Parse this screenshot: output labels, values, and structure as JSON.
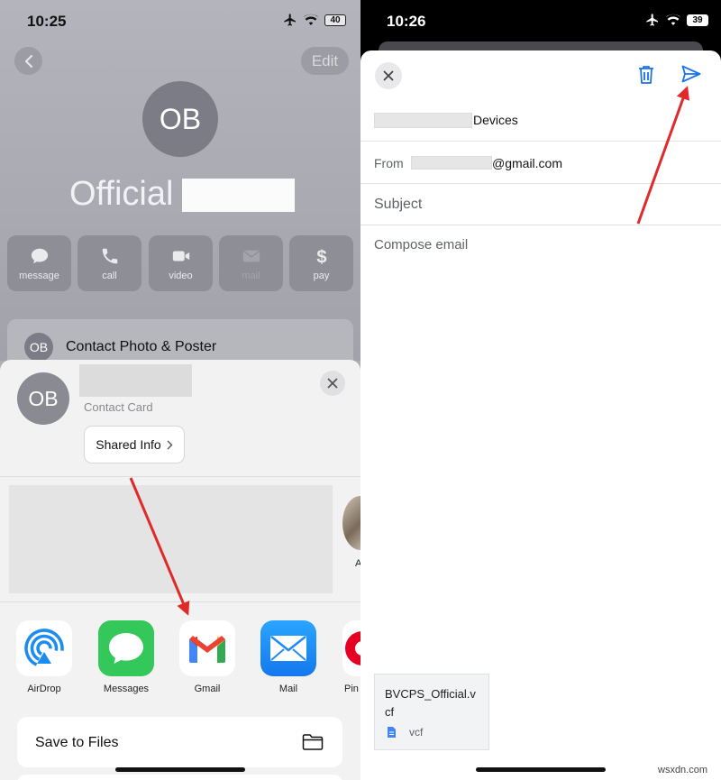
{
  "left": {
    "status": {
      "time": "10:25",
      "battery": "40"
    },
    "header": {
      "edit_label": "Edit"
    },
    "contact": {
      "initials": "OB",
      "name": "Official"
    },
    "actions": [
      {
        "label": "message",
        "icon": "message-bubble-icon",
        "enabled": true
      },
      {
        "label": "call",
        "icon": "phone-icon",
        "enabled": true
      },
      {
        "label": "video",
        "icon": "video-camera-icon",
        "enabled": true
      },
      {
        "label": "mail",
        "icon": "mail-icon",
        "enabled": false
      },
      {
        "label": "pay",
        "icon": "dollar-icon",
        "enabled": true
      }
    ],
    "contact_photo_row": {
      "initials": "OB",
      "label": "Contact Photo & Poster"
    },
    "share_sheet": {
      "initials": "OB",
      "subtitle": "Contact Card",
      "shared_info_label": "Shared Info",
      "people_peek_label": "A",
      "apps": [
        {
          "label": "AirDrop",
          "icon": "airdrop-icon"
        },
        {
          "label": "Messages",
          "icon": "messages-app-icon"
        },
        {
          "label": "Gmail",
          "icon": "gmail-app-icon"
        },
        {
          "label": "Mail",
          "icon": "mail-app-icon"
        },
        {
          "label": "Pin",
          "icon": "pinterest-app-icon"
        }
      ],
      "save_to_files_label": "Save to Files"
    }
  },
  "right": {
    "status": {
      "time": "10:26",
      "battery": "39"
    },
    "compose": {
      "to_suffix": "Devices",
      "from_label": "From",
      "from_value_suffix": "@gmail.com",
      "subject_placeholder": "Subject",
      "body_placeholder": "Compose email",
      "attachment": {
        "name_line1": "BVCPS_Official.v",
        "name_line2": "cf",
        "type": "vcf"
      }
    }
  },
  "watermark": "wsxdn.com",
  "colors": {
    "annotation_arrow": "#e02a2a",
    "gmail_blue": "#1a73e8",
    "messages_green": "#34c759",
    "mail_blue": "#1e8cf5",
    "airdrop_blue": "#1b8cf0"
  }
}
